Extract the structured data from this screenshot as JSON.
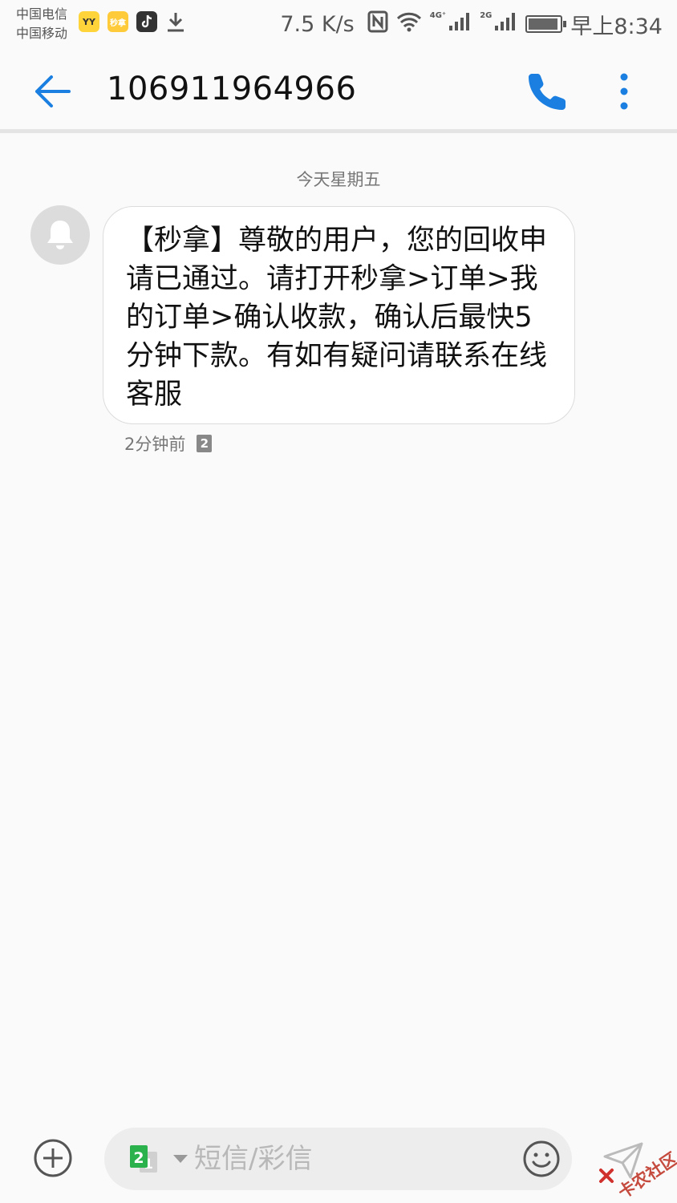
{
  "status_bar": {
    "carriers": [
      "中国电信",
      "中国移动"
    ],
    "app_icons": [
      {
        "name": "yy-app-icon",
        "label": "YY"
      },
      {
        "name": "miaona-app-icon",
        "label": "秒拿"
      },
      {
        "name": "tiktok-app-icon",
        "label": ""
      },
      {
        "name": "download-icon",
        "label": ""
      }
    ],
    "net_speed": "7.5 K/s",
    "sim1_network": "4G⁺",
    "sim2_network": "2G",
    "time": "早上8:34"
  },
  "header": {
    "title": "106911964966"
  },
  "conversation": {
    "day_label": "今天星期五",
    "messages": [
      {
        "text": "【秒拿】尊敬的用户，您的回收申请已通过。请打开秒拿>订单>我的订单>确认收款，确认后最快5分钟下款。有如有疑问请联系在线客服",
        "time": "2分钟前",
        "sim_badge": "2"
      }
    ]
  },
  "composer": {
    "placeholder": "短信/彩信",
    "sim_primary": "2",
    "sim_secondary": "1"
  },
  "watermark": "卡农社区",
  "colors": {
    "accent": "#1a7fe0",
    "background": "#fafafa",
    "bubble": "#ffffff",
    "sim_green": "#2bb24c"
  }
}
